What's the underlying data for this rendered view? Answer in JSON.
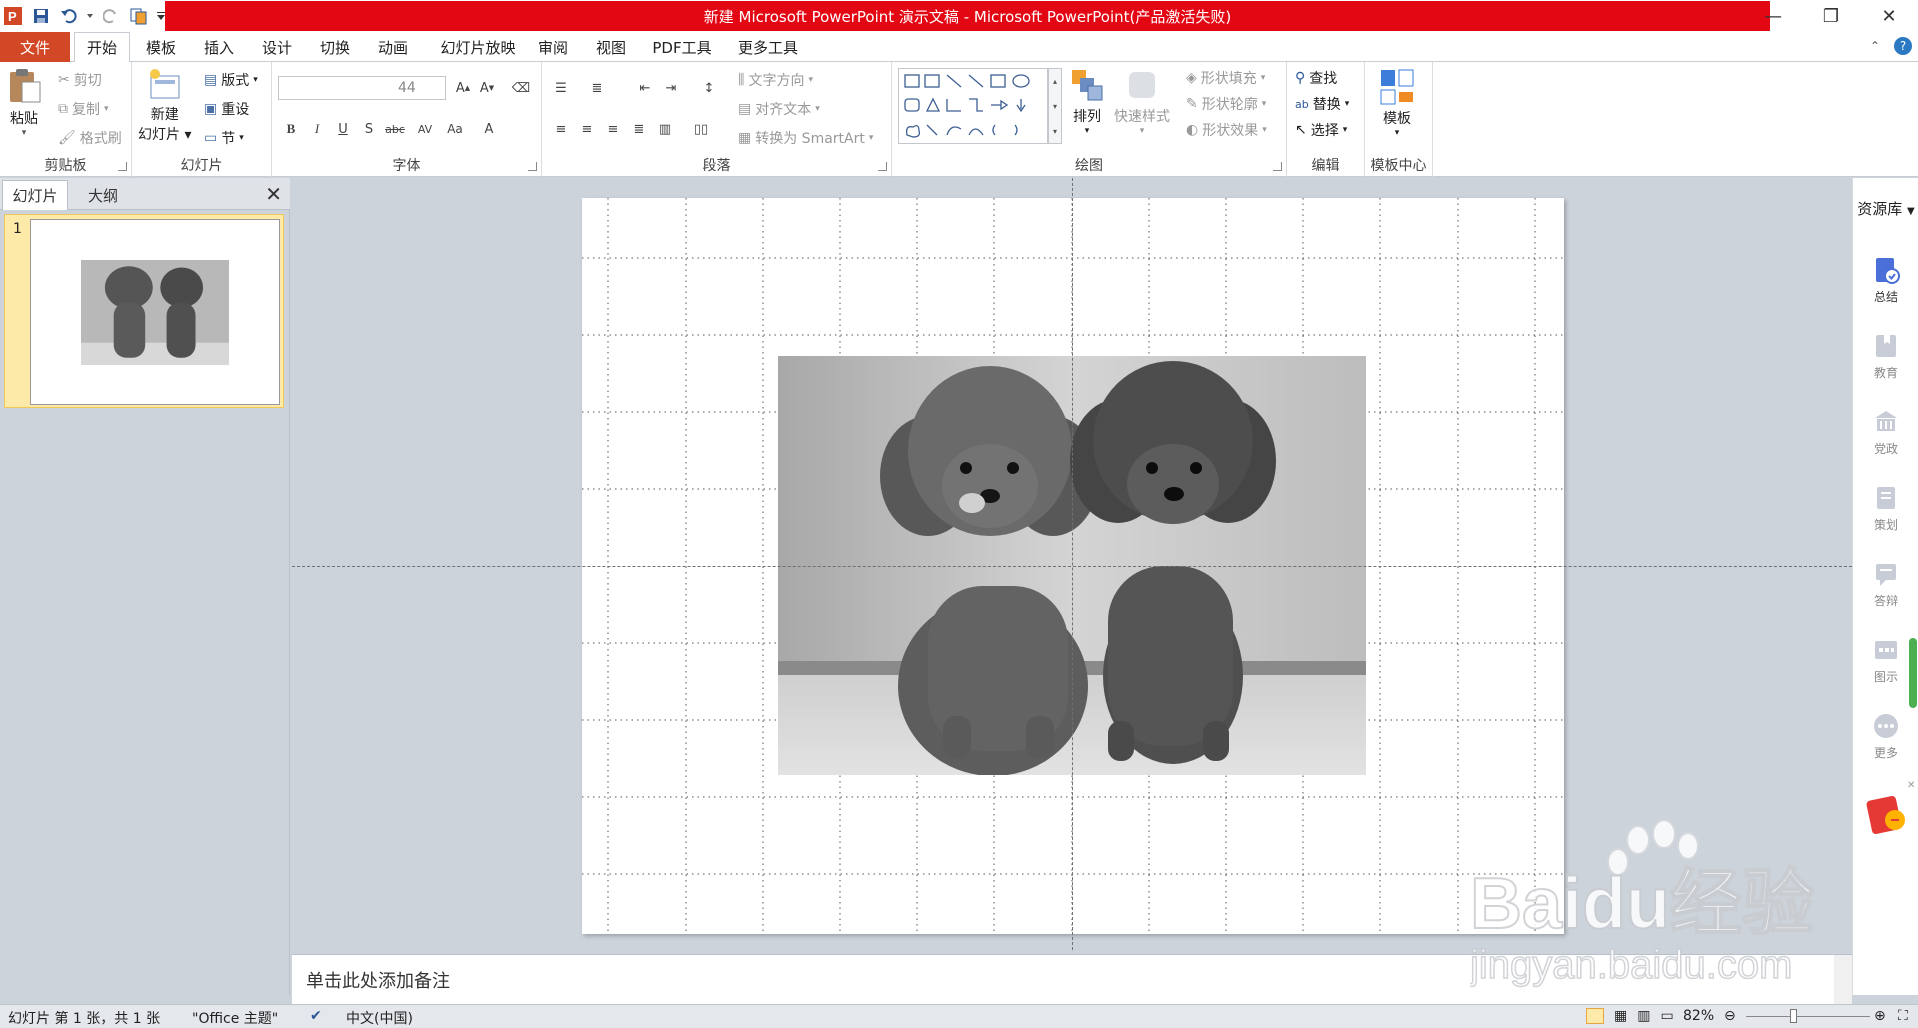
{
  "title": "新建 Microsoft PowerPoint 演示文稿 - Microsoft PowerPoint(产品激活失败)",
  "menu": {
    "file": "文件",
    "tabs": [
      "开始",
      "模板",
      "插入",
      "设计",
      "切换",
      "动画",
      "幻灯片放映",
      "审阅",
      "视图",
      "PDF工具",
      "更多工具"
    ],
    "active_tab": "开始"
  },
  "ribbon": {
    "clipboard": {
      "label": "剪贴板",
      "paste": "粘贴",
      "cut": "剪切",
      "copy": "复制",
      "format_painter": "格式刷"
    },
    "slides": {
      "label": "幻灯片",
      "new_slide_1": "新建",
      "new_slide_2": "幻灯片",
      "layout": "版式",
      "reset": "重设",
      "section": "节"
    },
    "font": {
      "label": "字体",
      "font_name": "",
      "font_size": "44"
    },
    "paragraph": {
      "label": "段落",
      "text_direction": "文字方向",
      "align_text": "对齐文本",
      "smartart": "转换为 SmartArt"
    },
    "drawing": {
      "label": "绘图",
      "arrange": "排列",
      "quick_styles": "快速样式",
      "shape_fill": "形状填充",
      "shape_outline": "形状轮廓",
      "shape_effects": "形状效果"
    },
    "editing": {
      "label": "编辑",
      "find": "查找",
      "replace": "替换",
      "select": "选择"
    },
    "template_center": {
      "label": "模板中心",
      "template": "模板"
    }
  },
  "left_pane": {
    "tab_slides": "幻灯片",
    "tab_outline": "大纲",
    "slide_number": "1"
  },
  "notes_placeholder": "单击此处添加备注",
  "right_sidebar": {
    "title": "资源库",
    "items": [
      "总结",
      "教育",
      "党政",
      "策划",
      "答辩",
      "图示",
      "更多"
    ]
  },
  "status": {
    "slide_info": "幻灯片 第 1 张，共 1 张",
    "theme": "\"Office 主题\"",
    "language": "中文(中国)",
    "zoom": "82%"
  },
  "watermark": {
    "brand": "Baidu经验",
    "url": "jingyan.baidu.com"
  }
}
